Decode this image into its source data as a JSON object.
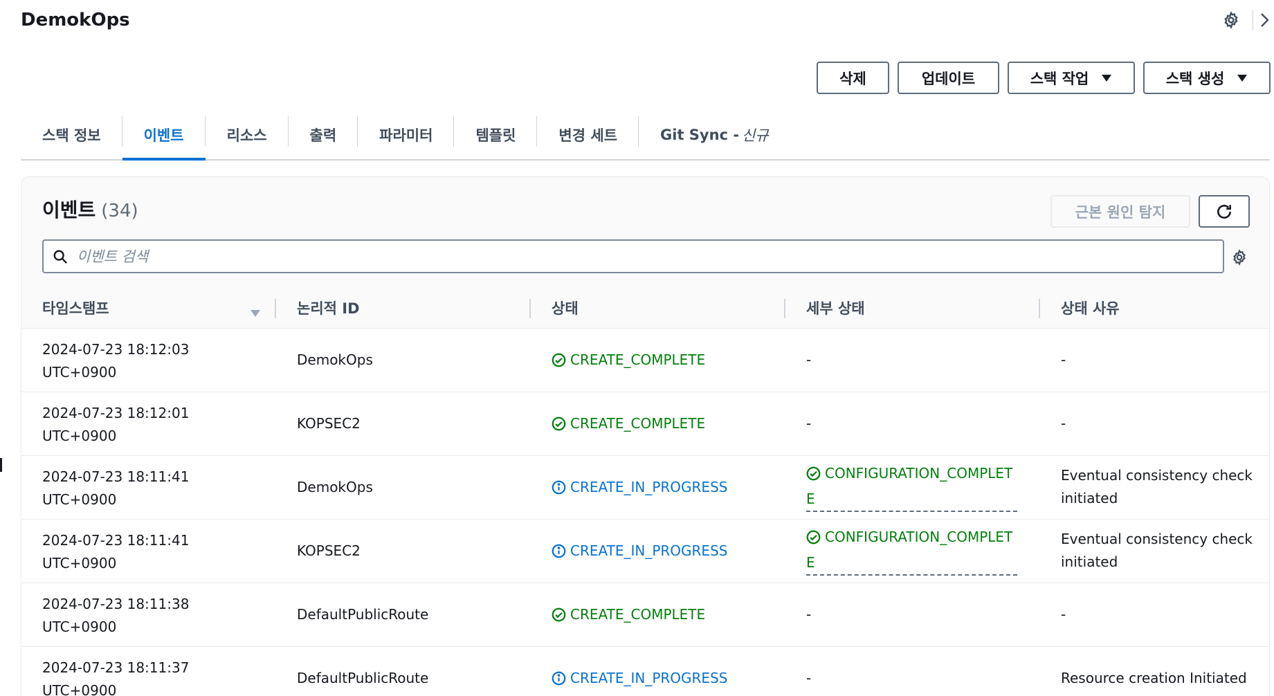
{
  "page": {
    "title": "DemokOps"
  },
  "actions": {
    "delete": "삭제",
    "update": "업데이트",
    "stack_actions": "스택 작업",
    "create_stack": "스택 생성"
  },
  "tabs": [
    {
      "label": "스택 정보"
    },
    {
      "label": "이벤트"
    },
    {
      "label": "리소스"
    },
    {
      "label": "출력"
    },
    {
      "label": "파라미터"
    },
    {
      "label": "템플릿"
    },
    {
      "label": "변경 세트"
    },
    {
      "label": "Git Sync - ",
      "tag": "신규"
    }
  ],
  "events": {
    "title": "이벤트",
    "count": "(34)",
    "root_cause_button": "근본 원인 탐지",
    "search_placeholder": "이벤트 검색",
    "columns": [
      "타임스탬프",
      "논리적 ID",
      "상태",
      "세부 상태",
      "상태 사유"
    ],
    "rows": [
      {
        "date": "2024-07-23 18:12:03",
        "tz": "UTC+0900",
        "logical_id": "DemokOps",
        "status": "CREATE_COMPLETE",
        "detail": "-",
        "reason": "-"
      },
      {
        "date": "2024-07-23 18:12:01",
        "tz": "UTC+0900",
        "logical_id": "KOPSEC2",
        "status": "CREATE_COMPLETE",
        "detail": "-",
        "reason": "-"
      },
      {
        "date": "2024-07-23 18:11:41",
        "tz": "UTC+0900",
        "logical_id": "DemokOps",
        "status": "CREATE_IN_PROGRESS",
        "detail": "CONFIGURATION_COMPLETE",
        "reason": "Eventual consistency check initiated"
      },
      {
        "date": "2024-07-23 18:11:41",
        "tz": "UTC+0900",
        "logical_id": "KOPSEC2",
        "status": "CREATE_IN_PROGRESS",
        "detail": "CONFIGURATION_COMPLETE",
        "reason": "Eventual consistency check initiated"
      },
      {
        "date": "2024-07-23 18:11:38",
        "tz": "UTC+0900",
        "logical_id": "DefaultPublicRoute",
        "status": "CREATE_COMPLETE",
        "detail": "-",
        "reason": "-"
      },
      {
        "date": "2024-07-23 18:11:37",
        "tz": "UTC+0900",
        "logical_id": "DefaultPublicRoute",
        "status": "CREATE_IN_PROGRESS",
        "detail": "-",
        "reason": "Resource creation Initiated"
      }
    ]
  },
  "colors": {
    "accent": "#0972d3",
    "success": "#037f0c",
    "text": "#16191f",
    "muted": "#414d5c"
  }
}
